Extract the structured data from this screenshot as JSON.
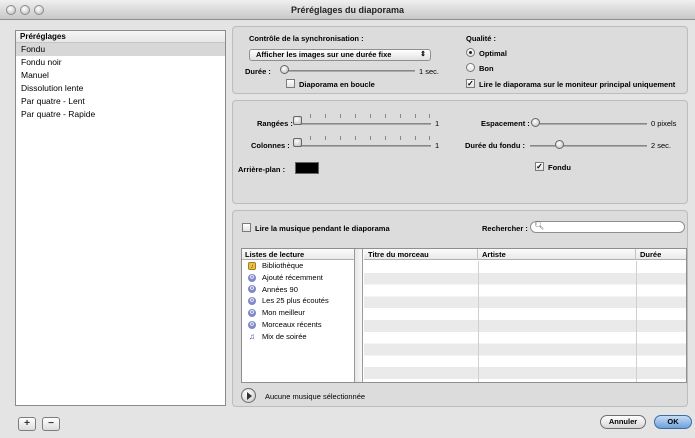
{
  "window": {
    "title": "Préréglages du diaporama"
  },
  "sidebar": {
    "header": "Préréglages",
    "items": [
      "Fondu",
      "Fondu noir",
      "Manuel",
      "Dissolution lente",
      "Par quatre - Lent",
      "Par quatre - Rapide"
    ],
    "selected": "Fondu",
    "add_label": "+",
    "remove_label": "−"
  },
  "sync": {
    "title": "Contrôle de la synchronisation :",
    "mode_value": "Afficher les images sur une durée fixe",
    "duration_label": "Durée :",
    "duration_value": "1 sec.",
    "loop_label": "Diaporama en boucle",
    "loop_checked": false
  },
  "quality": {
    "title": "Qualité :",
    "options": [
      "Optimal",
      "Bon"
    ],
    "selected": "Optimal",
    "main_monitor_label": "Lire le diaporama sur le moniteur principal uniquement",
    "main_monitor_checked": true
  },
  "grid": {
    "rows_label": "Rangées :",
    "rows_value": "1",
    "cols_label": "Colonnes :",
    "cols_value": "1",
    "background_label": "Arrière-plan :",
    "background_color": "#000000",
    "spacing_label": "Espacement :",
    "spacing_value": "0 pixels",
    "fade_duration_label": "Durée du fondu :",
    "fade_duration_value": "2 sec.",
    "fade_label": "Fondu",
    "fade_checked": true
  },
  "music": {
    "play_music_label": "Lire la musique pendant le diaporama",
    "play_music_checked": false,
    "search_label": "Rechercher :",
    "search_value": "",
    "playlists_header": "Listes de lecture",
    "playlists": [
      {
        "icon": "library-icon",
        "label": "Bibliothèque"
      },
      {
        "icon": "smart-playlist-icon",
        "label": "Ajouté récemment"
      },
      {
        "icon": "smart-playlist-icon",
        "label": "Années 90"
      },
      {
        "icon": "smart-playlist-icon",
        "label": "Les 25 plus écoutés"
      },
      {
        "icon": "smart-playlist-icon",
        "label": "Mon meilleur"
      },
      {
        "icon": "smart-playlist-icon",
        "label": "Morceaux récents"
      },
      {
        "icon": "playlist-icon",
        "label": "Mix de soirée"
      }
    ],
    "columns": [
      "Titre du morceau",
      "Artiste",
      "Durée"
    ],
    "status": "Aucune musique sélectionnée"
  },
  "buttons": {
    "cancel": "Annuler",
    "ok": "OK"
  }
}
